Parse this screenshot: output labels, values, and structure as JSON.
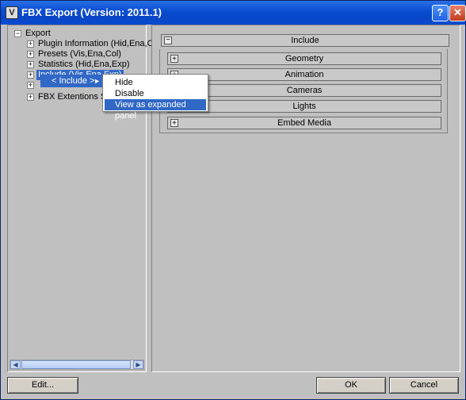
{
  "window": {
    "title": "FBX Export (Version: 2011.1)",
    "help_glyph": "?",
    "close_glyph": "✕",
    "app_icon_glyph": "V"
  },
  "tree": {
    "root_label": "Export",
    "root_expander": "−",
    "items": [
      {
        "label": "Plugin Information (Hid,Ena,Col)",
        "expander": "+"
      },
      {
        "label": "Presets (Vis,Ena,Col)",
        "expander": "+"
      },
      {
        "label": "Statistics (Hid,Ena,Exp)",
        "expander": "+"
      },
      {
        "label": "Include (Vis,Ena,Exp)",
        "expander": "+"
      },
      {
        "label": "",
        "expander": "+"
      },
      {
        "label": "FBX Extentions SDK",
        "expander": "+"
      }
    ]
  },
  "submenu": {
    "label": "< Include >",
    "arrow": "►"
  },
  "context_menu": {
    "items": [
      {
        "label": "Hide"
      },
      {
        "label": "Disable"
      },
      {
        "label": "View as expanded panel"
      }
    ]
  },
  "rollouts": {
    "include": {
      "label": "Include",
      "toggle": "−"
    },
    "children": [
      {
        "label": "Geometry",
        "toggle": "+"
      },
      {
        "label": "Animation",
        "toggle": "+"
      },
      {
        "label": "Cameras",
        "toggle": "+"
      },
      {
        "label": "Lights",
        "toggle": "+"
      },
      {
        "label": "Embed Media",
        "toggle": "+"
      }
    ]
  },
  "scrollbar": {
    "left_arrow": "◀",
    "right_arrow": "▶"
  },
  "buttons": {
    "edit": "Edit...",
    "ok": "OK",
    "cancel": "Cancel"
  }
}
